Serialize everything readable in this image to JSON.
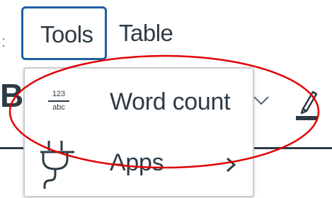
{
  "menubar": {
    "edge_glyph": ":",
    "tools_label": "Tools",
    "table_label": "Table"
  },
  "toolbar": {
    "bold_glyph": "B",
    "dropdown_icon": "chevron-down-icon",
    "highlight_icon": "highlight-pen-icon"
  },
  "dropdown": {
    "items": [
      {
        "label": "Word count",
        "icon": "word-count-icon",
        "icon_top": "123",
        "icon_bottom": "abc"
      },
      {
        "label": "Apps",
        "icon": "plug-icon",
        "submenu_icon": "chevron-right-icon"
      }
    ]
  },
  "colors": {
    "text": "#2d3b45",
    "focus_border": "#1f5fa3",
    "dropdown_border": "#c7cdd1",
    "annotation": "#e00000"
  },
  "annotation": {
    "shape": "ellipse",
    "color": "red",
    "encloses": "Word count"
  }
}
